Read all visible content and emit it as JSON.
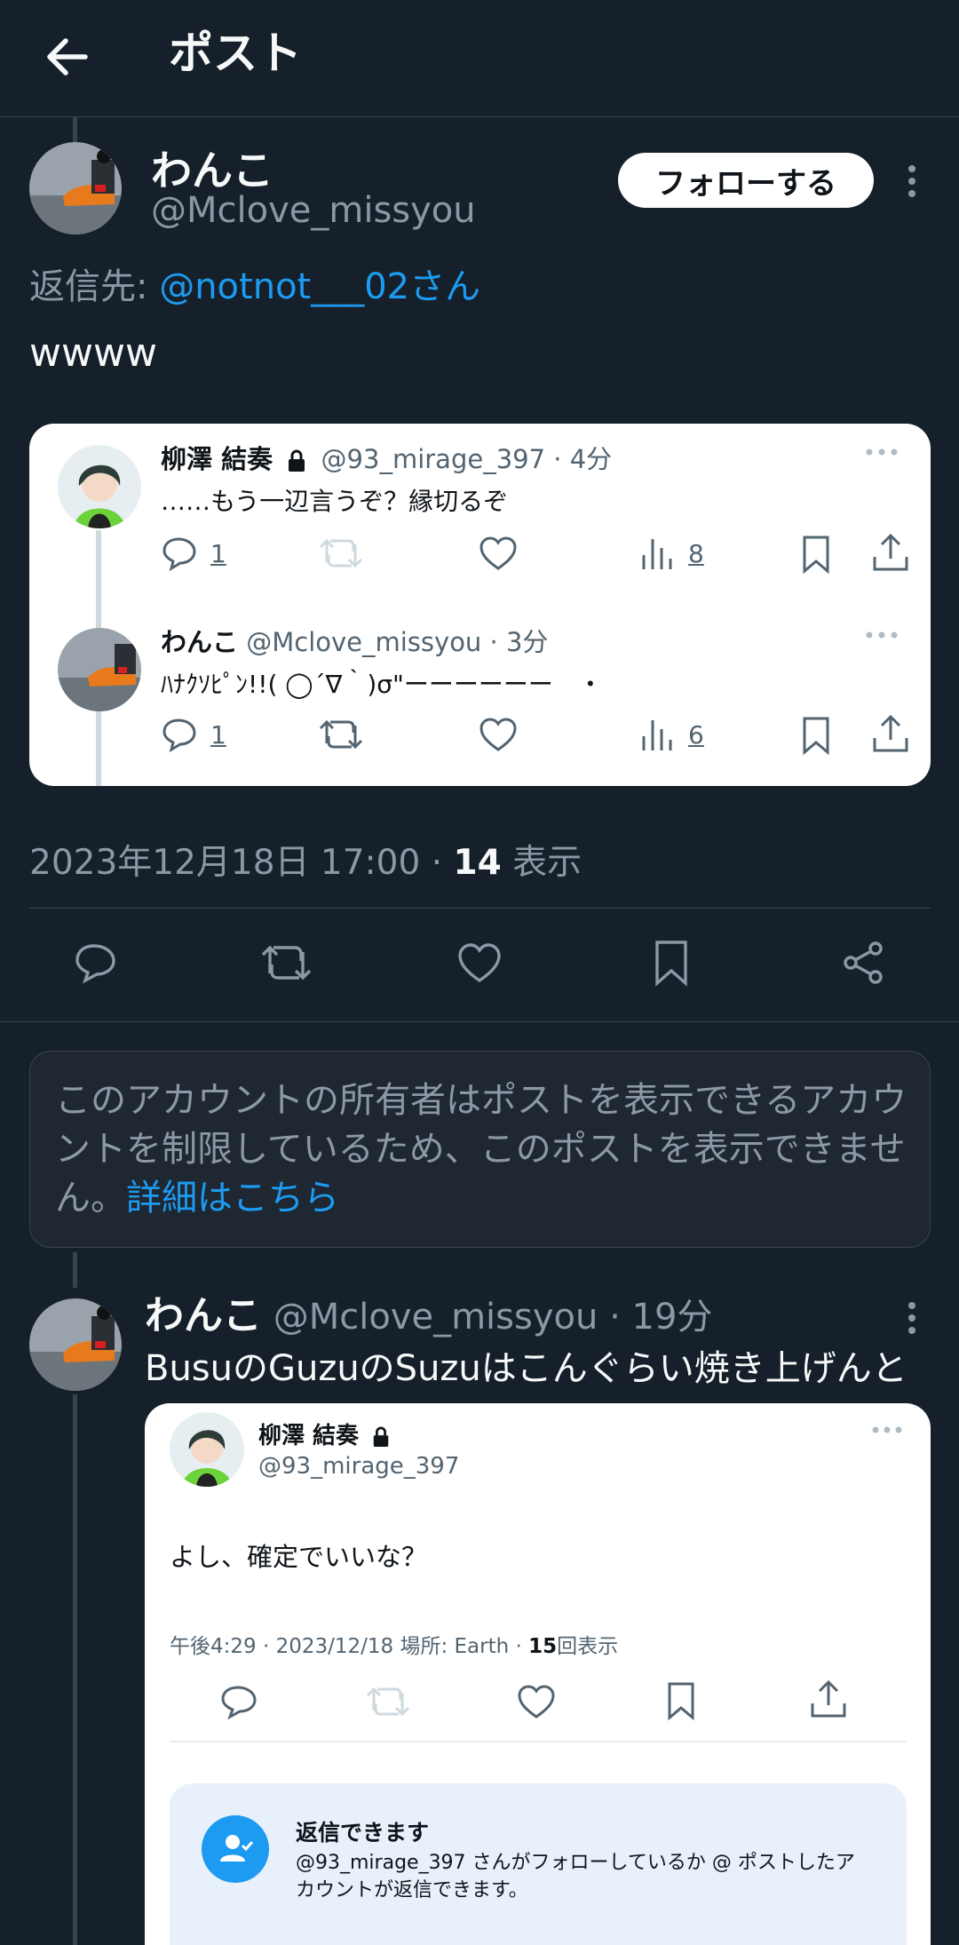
{
  "header": {
    "title": "ポスト"
  },
  "main_post": {
    "name": "わんこ",
    "handle": "@Mclove_missyou",
    "follow_label": "フォローする",
    "reply_prefix": "返信先:",
    "reply_to": "@notnot___02さん",
    "text": "wwww",
    "timestamp": "2023年12月18日 17:00 · ",
    "views_count": "14",
    "views_label": " 表示"
  },
  "embedded_thread": {
    "tweets": [
      {
        "name": "柳澤 結奏",
        "handle": "@93_mirage_397",
        "time": "· 4分",
        "text": "……もう一辺言うぞ？縁切るぞ",
        "reply_count": "1",
        "view_count": "8"
      },
      {
        "name": "わんこ",
        "handle": "@Mclove_missyou",
        "time": "· 3分",
        "text": "ﾊﾅｸｿﾋﾟﾝ!!( ◯´∇｀)σ\"ーーーーーー　・",
        "reply_count": "1",
        "view_count": "6"
      }
    ]
  },
  "notice": {
    "text": "このアカウントの所有者はポストを表示できるアカウントを制限しているため、このポストを表示できません。",
    "link": "詳細はこちら"
  },
  "reply_post": {
    "name": "わんこ",
    "handle": "@Mclove_missyou",
    "time": "· 19分",
    "text": "BusuのGuzuのSuzuはこんぐらい焼き上げんと"
  },
  "embedded_detail": {
    "name": "柳澤 結奏",
    "handle": "@93_mirage_397",
    "text": "よし、確定でいいな？",
    "meta": "午後4:29 · 2023/12/18 場所: Earth · ",
    "views_count": "15",
    "views_label": "回表示",
    "reply_notice_title": "返信できます",
    "reply_notice_text": "@93_mirage_397 さんがフォローしているか @ ポストしたアカウントが返信できます。"
  },
  "colors": {
    "background": "#15202b",
    "accent": "#1d9bf0",
    "muted": "#8b98a5"
  }
}
